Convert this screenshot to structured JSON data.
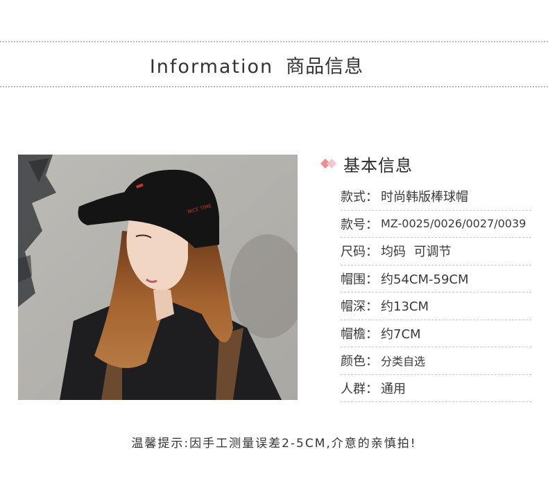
{
  "header": {
    "title_en": "Information",
    "title_zh": "商品信息"
  },
  "info": {
    "title": "基本信息",
    "rows": [
      {
        "label": "款式",
        "sep": "：",
        "value": "时尚韩版棒球帽"
      },
      {
        "label": "款号",
        "sep": "：",
        "value": "MZ-0025/0026/0027/0039"
      },
      {
        "label": "尺码",
        "sep": "：",
        "value": "均码  可调节"
      },
      {
        "label": "帽围",
        "sep": "：",
        "value": "约54CM-59CM"
      },
      {
        "label": "帽深",
        "sep": "：",
        "value": "约13CM"
      },
      {
        "label": "帽檐",
        "sep": "：",
        "value": "约7CM"
      },
      {
        "label": "颜色",
        "sep": "：",
        "value": "分类自选"
      },
      {
        "label": "人群",
        "sep": "：",
        "value": "通用"
      }
    ]
  },
  "footer": {
    "text": "温馨提示:因手工测量误差2-5CM,介意的亲慎拍!"
  },
  "colors": {
    "accent_pink": "#f08c93",
    "accent_pink_light": "#f6c3c5",
    "divider": "#b9b9b9"
  }
}
